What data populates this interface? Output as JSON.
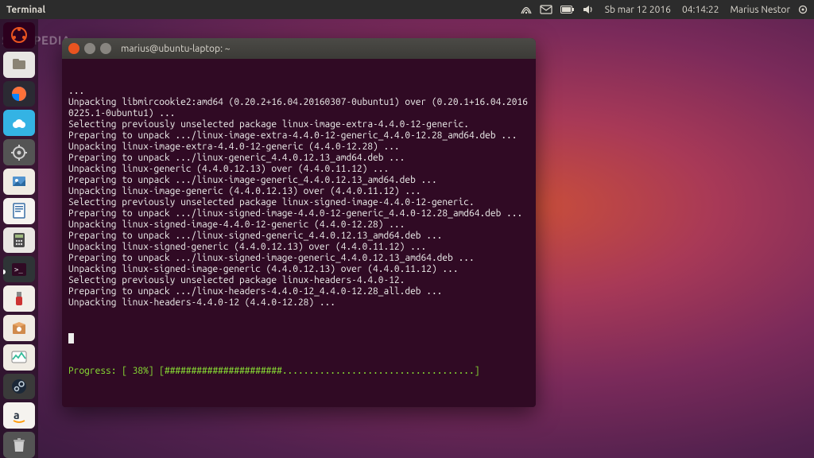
{
  "watermark": "SOFTPEDIA",
  "topbar": {
    "app_title": "Terminal",
    "date": "Sb mar 12 2016",
    "time": "04:14:22",
    "user": "Marius Nestor"
  },
  "terminal": {
    "title": "marius@ubuntu-laptop: ~",
    "lines": [
      "...",
      "Unpacking libmircookie2:amd64 (0.20.2+16.04.20160307-0ubuntu1) over (0.20.1+16.04.20160225.1-0ubuntu1) ...",
      "Selecting previously unselected package linux-image-extra-4.4.0-12-generic.",
      "Preparing to unpack .../linux-image-extra-4.4.0-12-generic_4.4.0-12.28_amd64.deb ...",
      "Unpacking linux-image-extra-4.4.0-12-generic (4.4.0-12.28) ...",
      "Preparing to unpack .../linux-generic_4.4.0.12.13_amd64.deb ...",
      "Unpacking linux-generic (4.4.0.12.13) over (4.4.0.11.12) ...",
      "Preparing to unpack .../linux-image-generic_4.4.0.12.13_amd64.deb ...",
      "Unpacking linux-image-generic (4.4.0.12.13) over (4.4.0.11.12) ...",
      "Selecting previously unselected package linux-signed-image-4.4.0-12-generic.",
      "Preparing to unpack .../linux-signed-image-4.4.0-12-generic_4.4.0-12.28_amd64.deb ...",
      "Unpacking linux-signed-image-4.4.0-12-generic (4.4.0-12.28) ...",
      "Preparing to unpack .../linux-signed-generic_4.4.0.12.13_amd64.deb ...",
      "Unpacking linux-signed-generic (4.4.0.12.13) over (4.4.0.11.12) ...",
      "Preparing to unpack .../linux-signed-image-generic_4.4.0.12.13_amd64.deb ...",
      "Unpacking linux-signed-image-generic (4.4.0.12.13) over (4.4.0.11.12) ...",
      "Selecting previously unselected package linux-headers-4.4.0-12.",
      "Preparing to unpack .../linux-headers-4.4.0-12_4.4.0-12.28_all.deb ...",
      "Unpacking linux-headers-4.4.0-12 (4.4.0-12.28) ..."
    ],
    "progress_label": "Progress: [ 38%]",
    "progress_bar": "[######################....................................]"
  },
  "launcher": {
    "items": [
      {
        "name": "dash-icon"
      },
      {
        "name": "files-icon"
      },
      {
        "name": "firefox-icon"
      },
      {
        "name": "weather-icon"
      },
      {
        "name": "settings-icon"
      },
      {
        "name": "photos-icon"
      },
      {
        "name": "writer-icon"
      },
      {
        "name": "calc-icon"
      },
      {
        "name": "terminal-icon"
      },
      {
        "name": "usb-creator-icon"
      },
      {
        "name": "software-icon"
      },
      {
        "name": "system-monitor-icon"
      },
      {
        "name": "steam-icon"
      },
      {
        "name": "amazon-icon"
      },
      {
        "name": "trash-icon"
      }
    ]
  }
}
